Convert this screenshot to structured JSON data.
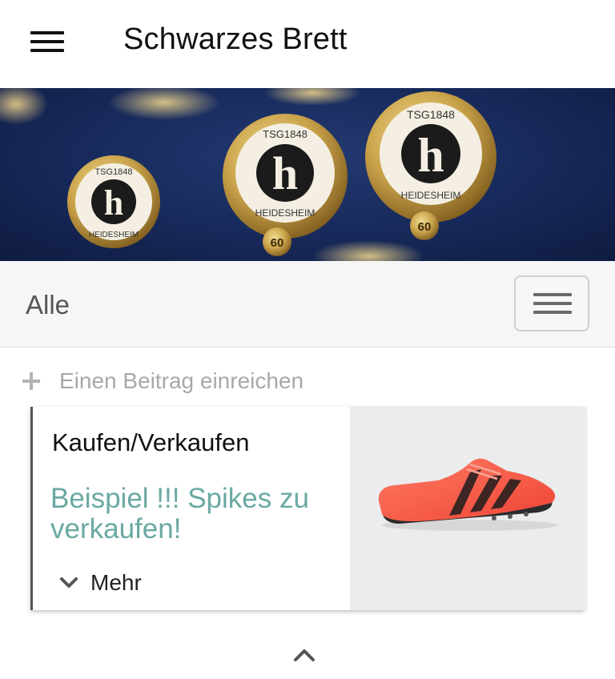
{
  "header": {
    "title": "Schwarzes Brett",
    "menu_icon": "hamburger-menu-icon"
  },
  "banner": {
    "pin_text_top": "TSG1848",
    "pin_text_bottom": "HEIDESHEIM",
    "pin_letter": "h",
    "pin_badge": "60",
    "colors": {
      "background": "#17295a",
      "gold": "#c9a24a"
    }
  },
  "filter": {
    "label": "Alle",
    "menu_icon": "filter-menu-icon"
  },
  "submit": {
    "icon": "plus-icon",
    "label": "Einen Beitrag einreichen"
  },
  "posts": [
    {
      "category": "Kaufen/Verkaufen",
      "title": "Beispiel !!! Spikes zu verkaufen!",
      "more_label": "Mehr",
      "more_icon": "chevron-down-icon",
      "image": "running-spike-shoe-image"
    }
  ],
  "footer": {
    "scroll_icon": "chevron-up-icon"
  },
  "colors": {
    "accent": "#6aa9a3",
    "muted_text": "#a8a8a8",
    "filter_bg": "#f6f6f6",
    "shoe": "#f25a4a"
  }
}
